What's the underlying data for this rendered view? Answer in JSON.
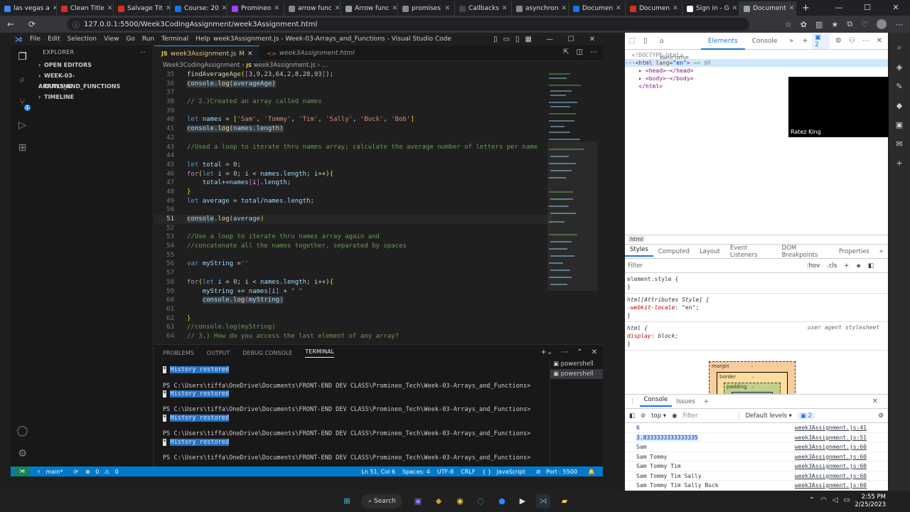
{
  "browser": {
    "tabs": [
      {
        "label": "las vegas a",
        "color": "#4285f4"
      },
      {
        "label": "Clean Title",
        "color": "#d93025"
      },
      {
        "label": "Salvage Tit",
        "color": "#d93025"
      },
      {
        "label": "Course: 20",
        "color": "#1a73e8"
      },
      {
        "label": "Promineo",
        "color": "#a142f4"
      },
      {
        "label": "arrow func",
        "color": "#888888"
      },
      {
        "label": "Arrow func",
        "color": "#9aa0a6"
      },
      {
        "label": "promises",
        "color": "#888888"
      },
      {
        "label": "Callbacks",
        "color": "#444444"
      },
      {
        "label": "asynchron",
        "color": "#888888"
      },
      {
        "label": "Documen",
        "color": "#1a73e8"
      },
      {
        "label": "Documen",
        "color": "#d93025"
      },
      {
        "label": "Sign in - G",
        "color": "#ffffff"
      },
      {
        "label": "Document",
        "color": "#9aa0a6",
        "active": true
      }
    ],
    "url": "127.0.0.1:5500/Week3CodingAssignment/week3Assignment.html"
  },
  "vscode": {
    "menu": [
      "File",
      "Edit",
      "Selection",
      "View",
      "Go",
      "Run",
      "Terminal",
      "Help"
    ],
    "window_title": "week3Assignment.js - Week-03-Arrays_and_Functions - Visual Studio Code",
    "sidebar": {
      "header": "EXPLORER",
      "sections": [
        "OPEN EDITORS",
        "WEEK-03-ARRAYS_AND_FUNCTIONS",
        "OUTLINE",
        "TIMELINE"
      ]
    },
    "editor_tabs": [
      {
        "label": "week3Assignment.js",
        "modified": "M",
        "active": true
      },
      {
        "label": "week3Assignment.html",
        "active": false
      }
    ],
    "breadcrumb": [
      "Week3CodingAssignment",
      "week3Assignment.js",
      "..."
    ],
    "current_line": 51,
    "panel_tabs": [
      "PROBLEMS",
      "OUTPUT",
      "DEBUG CONSOLE",
      "TERMINAL"
    ],
    "terminal": {
      "history_label": "History restored",
      "star": "*",
      "prompt": "PS C:\\Users\\tiffa\\OneDrive\\Documents\\FRONT-END DEV CLASS\\Promineo_Tech\\Week-03-Arrays_and_Functions>",
      "shells": [
        "powershell",
        "powershell"
      ]
    },
    "status": {
      "branch": "main*",
      "errors": "0",
      "warnings": "0",
      "position": "Ln 51, Col 6",
      "spaces": "Spaces: 4",
      "encoding": "UTF-8",
      "eol": "CRLF",
      "language": "JavaScript",
      "port": "Port : 5500"
    }
  },
  "devtools": {
    "tabs": [
      "Welcome",
      "Elements",
      "Console"
    ],
    "issues_count": "2",
    "dom": {
      "doctype": "<!DOCTYPE html>",
      "html_open": "<html",
      "lang_attr": "lang",
      "lang_val": "\"en\"",
      "eq": ">",
      "dollar": "== $0",
      "head": "<head>",
      "head_close": "</head>",
      "body": "<body>",
      "body_close": "</body>",
      "html_close": "</html>",
      "ellipsis": "⋯"
    },
    "webcam_label": "Ratez King",
    "crumb": "html",
    "styles_tabs": [
      "Styles",
      "Computed",
      "Layout",
      "Event Listeners",
      "DOM Breakpoints",
      "Properties"
    ],
    "filter_placeholder": "Filter",
    "hov": ":hov",
    "cls": ".cls",
    "rules": {
      "element_style": "element.style {",
      "close": "}",
      "attr_selector": "html[Attributes Style] {",
      "webkit_prop": "-webkit-locale",
      "webkit_val": "\"en\";",
      "html_selector": "html {",
      "ua_source": "user agent stylesheet",
      "display_prop": "display",
      "display_val": "block;"
    },
    "box_model": {
      "margin": "margin",
      "border": "border",
      "padding": "padding",
      "dash": "–"
    },
    "console": {
      "tabs": [
        "Console",
        "Issues"
      ],
      "context": "top",
      "filter": "Filter",
      "levels": "Default levels",
      "issues": "2",
      "rows": [
        {
          "text": "6",
          "src": "week3Assignment.js:41"
        },
        {
          "text": "3.8333333333333335",
          "src": "week3Assignment.js:51"
        },
        {
          "text": "Sam",
          "src": "week3Assignment.js:60"
        },
        {
          "text": "Sam Tommy",
          "src": "week3Assignment.js:60"
        },
        {
          "text": "Sam Tommy Tim",
          "src": "week3Assignment.js:60"
        },
        {
          "text": "Sam Tommy Tim Sally",
          "src": "week3Assignment.js:60"
        },
        {
          "text": "Sam Tommy Tim Sally Buck",
          "src": "week3Assignment.js:60"
        }
      ]
    }
  },
  "taskbar": {
    "search": "Search",
    "time": "2:55 PM",
    "date": "2/25/2023"
  }
}
